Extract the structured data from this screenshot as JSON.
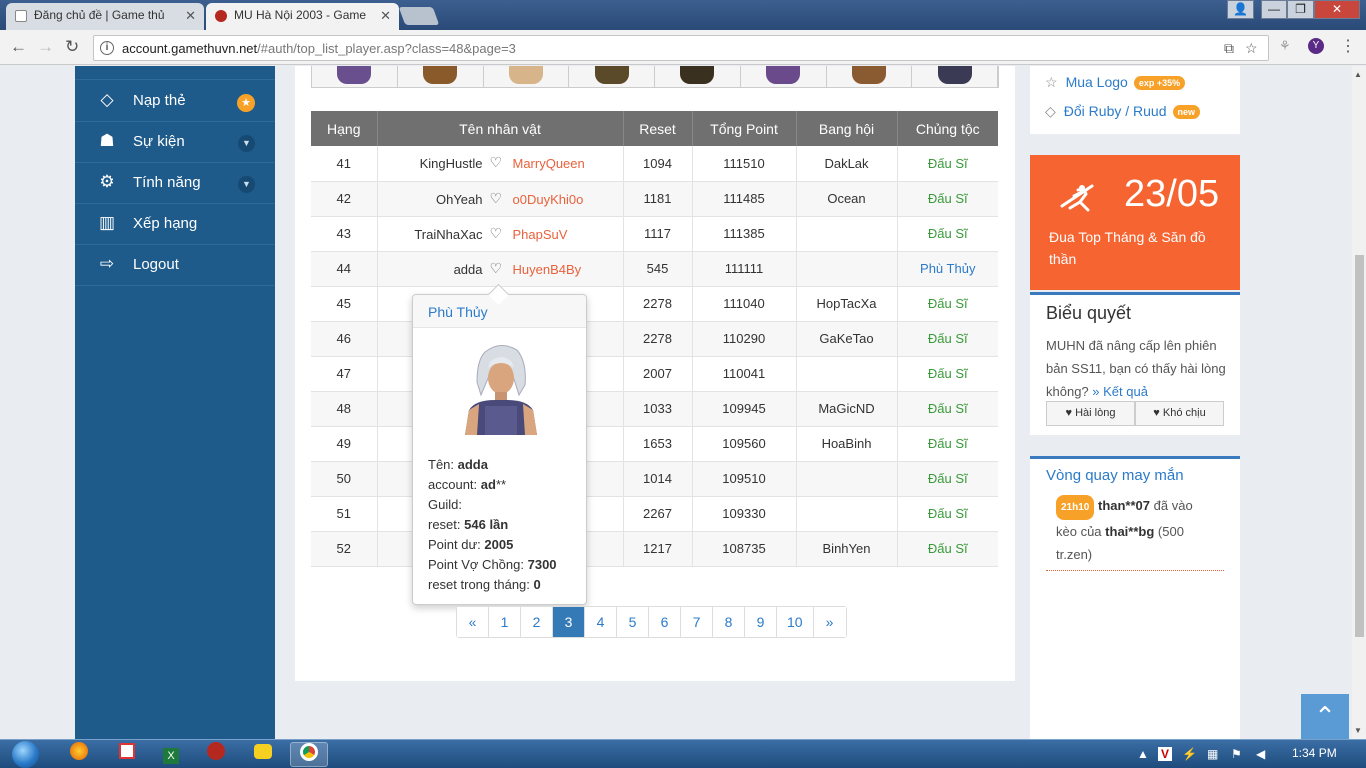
{
  "browser": {
    "tabs": [
      {
        "title": "Đăng chủ đề | Game thủ",
        "close": "✕"
      },
      {
        "title": "MU Hà Nội 2003 - Game",
        "close": "✕"
      }
    ],
    "url_host": "account.gamethuvn.net",
    "url_path": "/#auth/top_list_player.asp?class=48&page=3",
    "profile_initial": "Y"
  },
  "sidebar": {
    "items": [
      {
        "label": "Nạp thẻ",
        "icon": "diamond-icon"
      },
      {
        "label": "Sự kiện",
        "icon": "android-icon"
      },
      {
        "label": "Tính năng",
        "icon": "gears-icon"
      },
      {
        "label": "Xếp hạng",
        "icon": "bar-chart-icon"
      },
      {
        "label": "Logout",
        "icon": "sign-out-icon"
      }
    ]
  },
  "table": {
    "headers": [
      "Hạng",
      "Tên nhân vật",
      "Reset",
      "Tổng Point",
      "Bang hội",
      "Chủng tộc"
    ],
    "rows": [
      {
        "rank": "41",
        "name": "KingHustle",
        "partner": "MarryQueen",
        "reset": "1094",
        "point": "111510",
        "guild": "DakLak",
        "race": "Đấu Sĩ"
      },
      {
        "rank": "42",
        "name": "OhYeah",
        "partner": "o0DuyKhi0o",
        "reset": "1181",
        "point": "111485",
        "guild": "Ocean",
        "race": "Đấu Sĩ"
      },
      {
        "rank": "43",
        "name": "TraiNhaXac",
        "partner": "PhapSuV",
        "reset": "1117",
        "point": "111385",
        "guild": "",
        "race": "Đấu Sĩ"
      },
      {
        "rank": "44",
        "name": "adda",
        "partner": "HuyenB4By",
        "reset": "545",
        "point": "111111",
        "guild": "",
        "race": "Phù Thủy"
      },
      {
        "rank": "45",
        "name": "",
        "partner": "",
        "reset": "2278",
        "point": "111040",
        "guild": "HopTacXa",
        "race": "Đấu Sĩ"
      },
      {
        "rank": "46",
        "name": "",
        "partner": "",
        "reset": "2278",
        "point": "110290",
        "guild": "GaKeTao",
        "race": "Đấu Sĩ"
      },
      {
        "rank": "47",
        "name": "",
        "partner": "",
        "reset": "2007",
        "point": "110041",
        "guild": "",
        "race": "Đấu Sĩ"
      },
      {
        "rank": "48",
        "name": "",
        "partner": "",
        "reset": "1033",
        "point": "109945",
        "guild": "MaGicND",
        "race": "Đấu Sĩ"
      },
      {
        "rank": "49",
        "name": "",
        "partner": "",
        "reset": "1653",
        "point": "109560",
        "guild": "HoaBinh",
        "race": "Đấu Sĩ"
      },
      {
        "rank": "50",
        "name": "",
        "partner": "",
        "reset": "1014",
        "point": "109510",
        "guild": "",
        "race": "Đấu Sĩ"
      },
      {
        "rank": "51",
        "name": "",
        "partner": "",
        "reset": "2267",
        "point": "109330",
        "guild": "",
        "race": "Đấu Sĩ"
      },
      {
        "rank": "52",
        "name": "",
        "partner": "",
        "reset": "1217",
        "point": "108735",
        "guild": "BinhYen",
        "race": "Đấu Sĩ"
      }
    ]
  },
  "tooltip": {
    "title": "Phù Thủy",
    "name_label": "Tên:",
    "name": "adda",
    "account_label": "account:",
    "account": "ad",
    "account_mask": "**",
    "guild_label": "Guild:",
    "reset_label": "reset:",
    "reset": "546 lần",
    "point_label": "Point dư:",
    "point": "2005",
    "couple_label": "Point Vợ Chồng:",
    "couple": "7300",
    "month_label": "reset trong tháng:",
    "month": "0"
  },
  "pager": {
    "prev": "«",
    "pages": [
      "1",
      "2",
      "3",
      "4",
      "5",
      "6",
      "7",
      "8",
      "9",
      "10"
    ],
    "current": "3",
    "next": "»"
  },
  "right": {
    "mua_logo": "Mua Logo",
    "mua_badge": "exp +35%",
    "ruby": "Đổi Ruby / Ruud",
    "ruby_badge": "new",
    "event_date": "23/05",
    "event_desc": "Đua Top Tháng & Săn đồ thần",
    "poll_title": "Biểu quyết",
    "poll_q": "MUHN đã nâng cấp lên phiên bản SS11, bạn có thấy hài lòng không?",
    "poll_link": "» Kết quả",
    "poll_yes": "Hài lòng",
    "poll_no": "Khó chịu",
    "wheel_title": "Vòng quay may mắn",
    "wheel_time": "21h10",
    "wheel_user": "than**07",
    "wheel_mid": "đã vào kèo của",
    "wheel_target": "thai**bg",
    "wheel_amount": "(500 tr.zen)"
  },
  "taskbar": {
    "clock": "1:34 PM"
  }
}
